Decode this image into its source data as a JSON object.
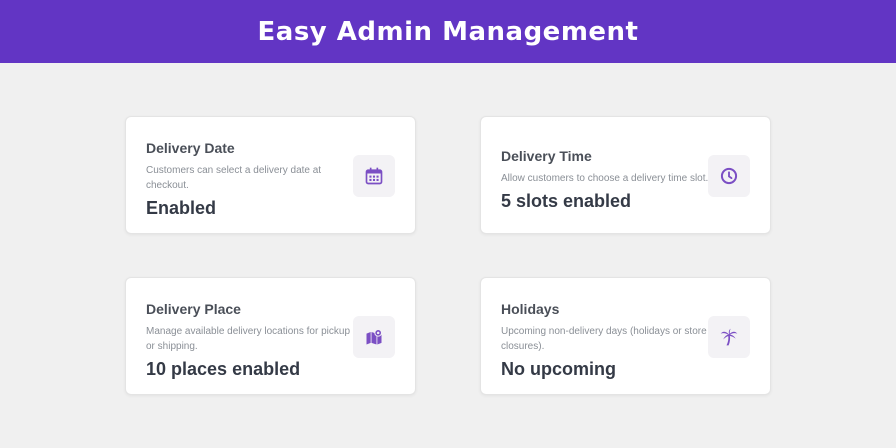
{
  "header": {
    "title": "Easy Admin Management"
  },
  "colors": {
    "brand": "#6235c4",
    "icon": "#7b4fc4"
  },
  "cards": [
    {
      "title": "Delivery Date",
      "description": "Customers can select a delivery date at checkout.",
      "value": "Enabled",
      "icon": "calendar-icon"
    },
    {
      "title": "Delivery Time",
      "description": "Allow customers to choose a delivery time slot.",
      "value": "5 slots enabled",
      "icon": "clock-icon"
    },
    {
      "title": "Delivery Place",
      "description": "Manage available delivery locations for pickup or shipping.",
      "value": "10 places enabled",
      "icon": "map-pin-icon"
    },
    {
      "title": "Holidays",
      "description": "Upcoming non-delivery days (holidays or store closures).",
      "value": "No upcoming",
      "icon": "palm-tree-icon"
    }
  ]
}
